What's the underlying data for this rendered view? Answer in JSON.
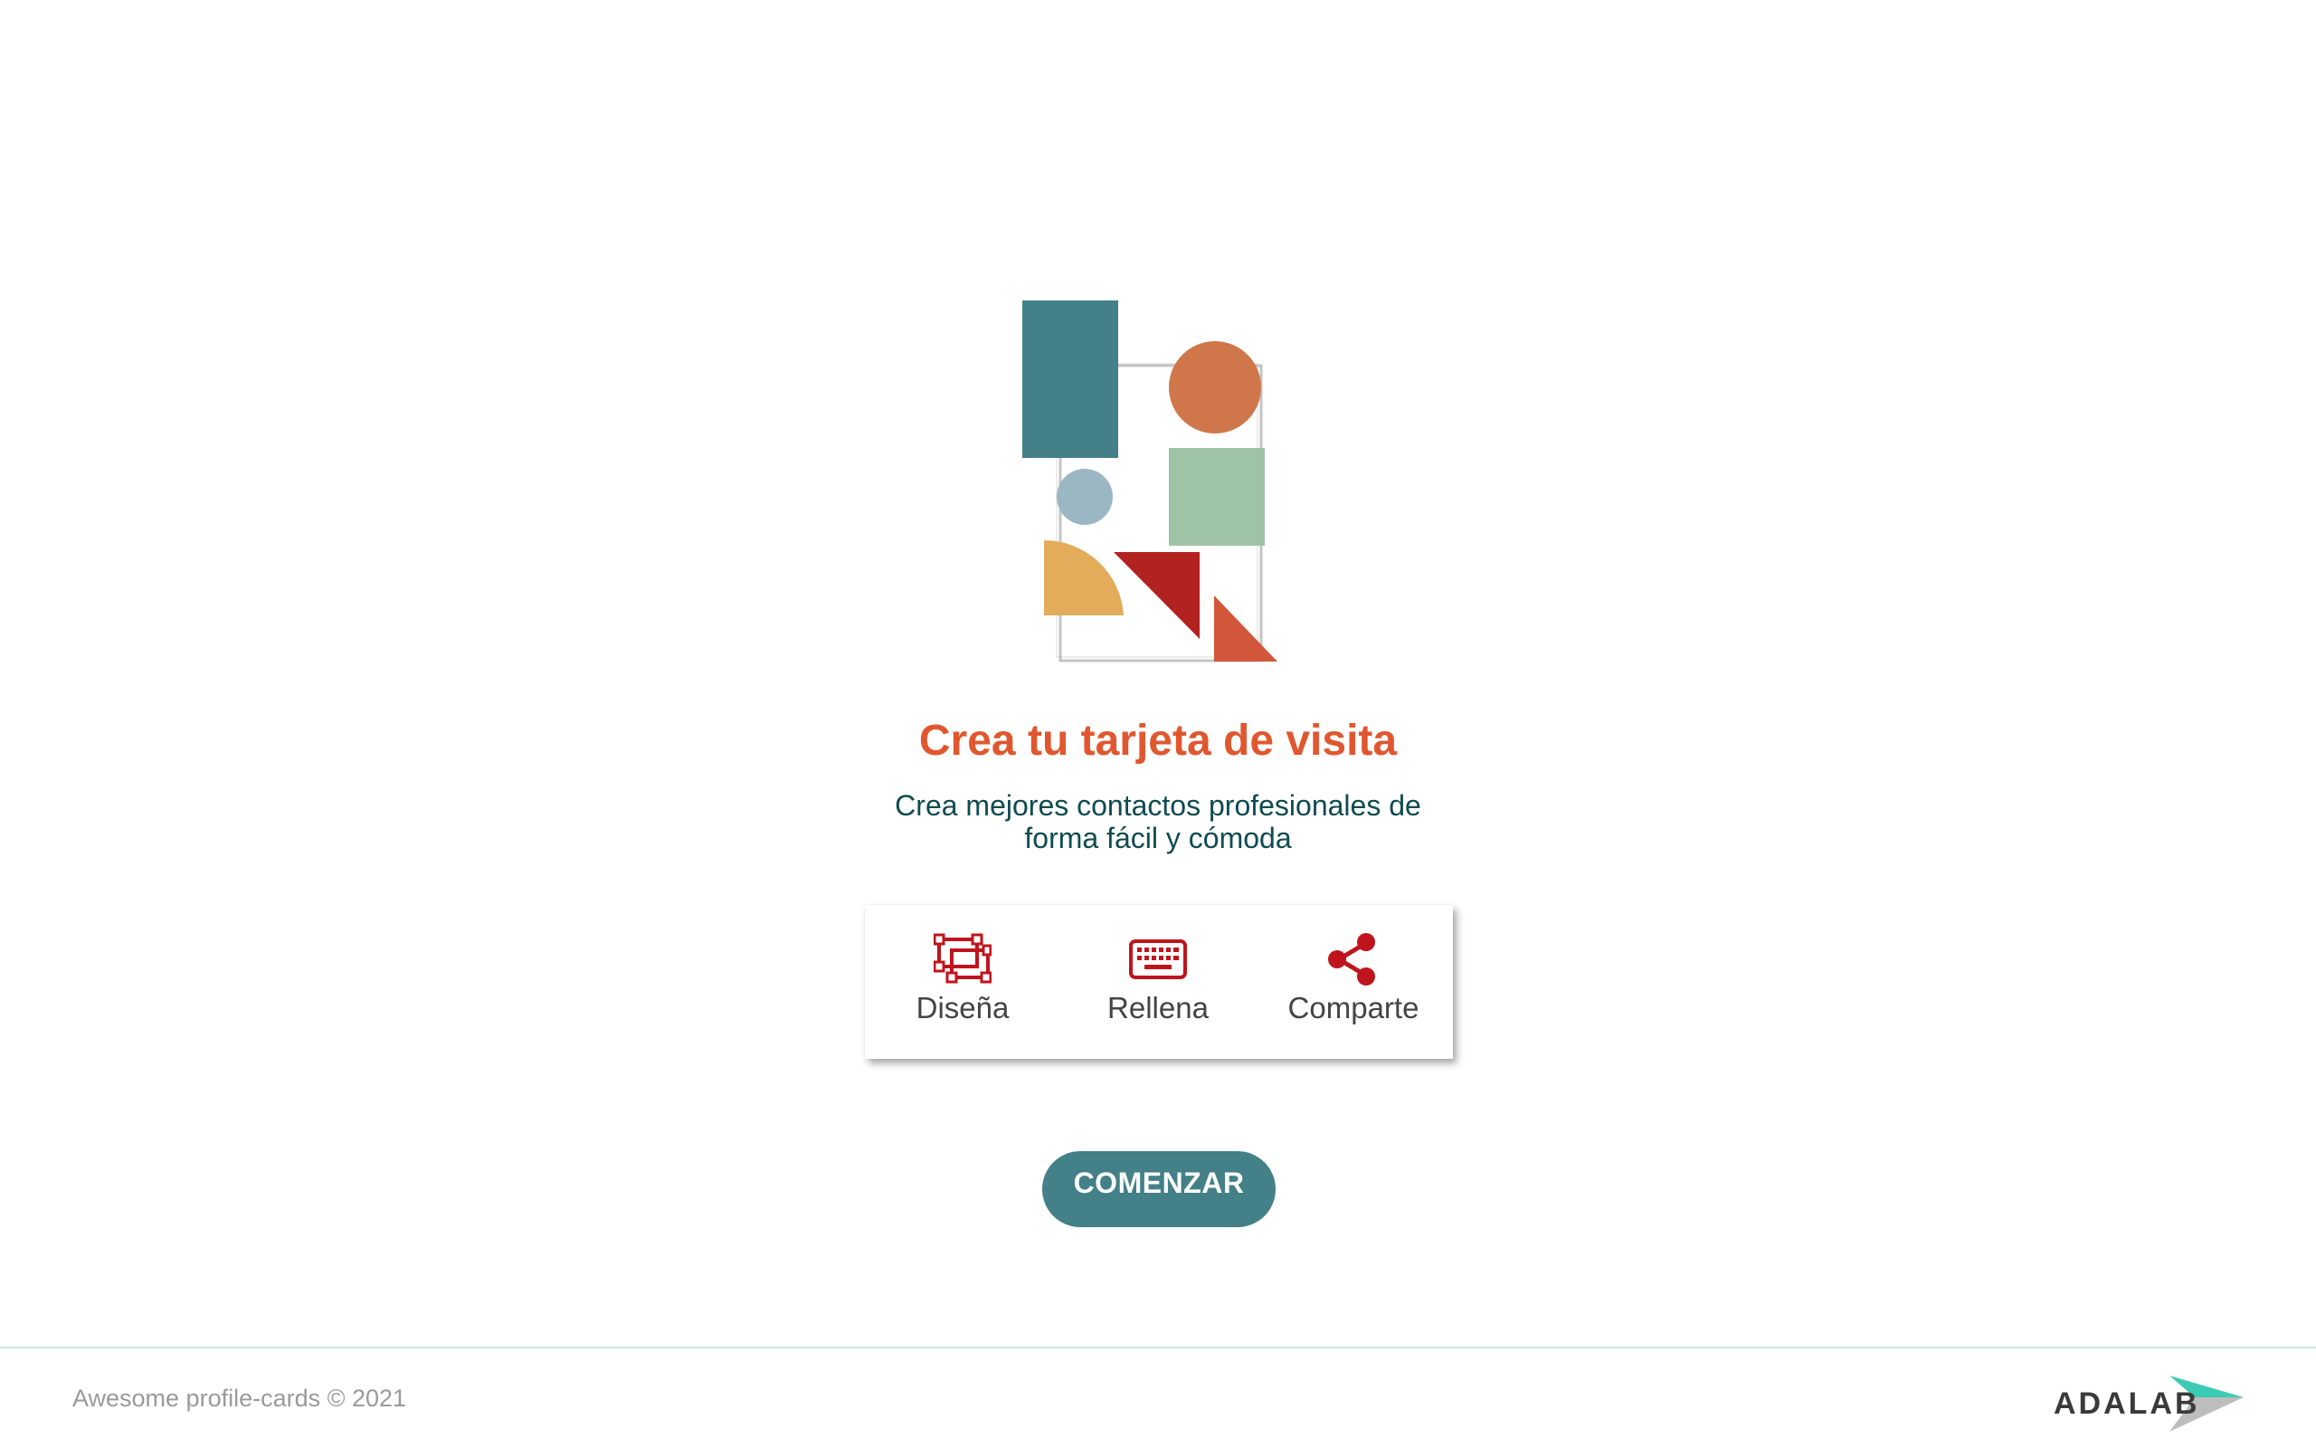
{
  "hero": {
    "title": "Crea tu tarjeta de visita",
    "subtitle": "Crea mejores contactos profesionales de forma fácil y cómoda"
  },
  "steps": [
    {
      "label": "Diseña",
      "icon": "design-icon"
    },
    {
      "label": "Rellena",
      "icon": "keyboard-icon"
    },
    {
      "label": "Comparte",
      "icon": "share-icon"
    }
  ],
  "cta": {
    "label": "COMENZAR"
  },
  "footer": {
    "copyright": "Awesome profile-cards © 2021",
    "brand": "ADALAB"
  },
  "colors": {
    "accent": "#e0572f",
    "primary": "#438087",
    "icon_red": "#c0141d",
    "text_dark": "#0f4b50"
  }
}
